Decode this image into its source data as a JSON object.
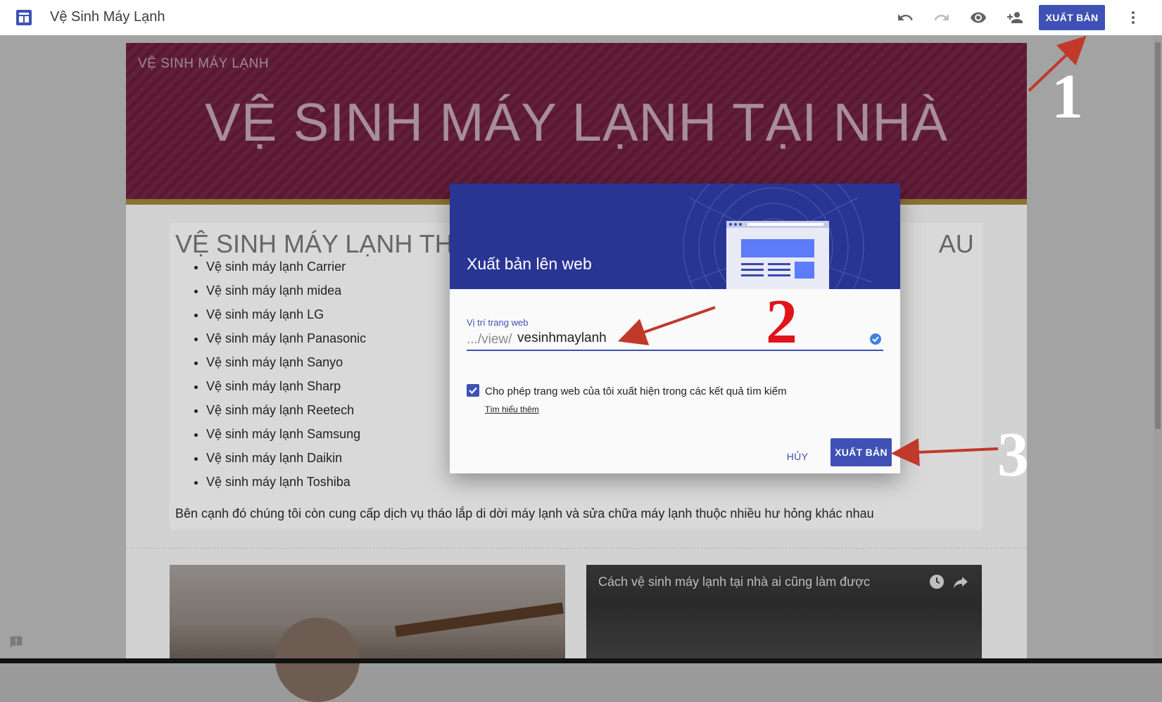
{
  "app": {
    "title": "Vệ Sinh Máy Lạnh",
    "publish_label": "XUẤT BẢN",
    "toolbar_icons": [
      "undo-icon",
      "redo-icon",
      "preview-icon",
      "share-icon",
      "more-vert-icon"
    ]
  },
  "site": {
    "site_name": "VỆ SINH MÁY LẠNH",
    "hero_title": "VỆ SINH MÁY LẠNH TẠI NHÀ",
    "section_title": "VỆ SINH MÁY LẠNH TH",
    "section_title_tail": "AU",
    "brands": [
      "Vệ sinh máy lạnh Carrier",
      "Vệ sinh máy lạnh midea",
      "Vệ sinh máy lạnh LG",
      "Vệ sinh máy lạnh Panasonic",
      "Vệ sinh máy lạnh Sanyo",
      "Vệ sinh máy lạnh Sharp",
      "Vệ sinh máy lạnh Reetech",
      "Vệ sinh máy lạnh Samsung",
      "Vệ sinh máy lạnh Daikin",
      "Vệ sinh máy lạnh Toshiba"
    ],
    "body_text": "Bên cạnh đó chúng tôi còn cung cấp dịch vụ tháo lắp di dời máy lạnh và sửa chữa máy lạnh thuộc nhiều hư hỏng khác nhau",
    "video_title": "Cách vệ sinh máy lạnh tại nhà ai cũng làm được"
  },
  "dialog": {
    "title": "Xuất bản lên web",
    "field_label": "Vị trí trang web",
    "field_prefix": ".../view/",
    "field_value": "vesinhmaylanh",
    "checkbox_checked": true,
    "checkbox_label": "Cho phép trang web của tôi xuất hiện trong các kết quả tìm kiếm",
    "learn_more": "Tìm hiểu thêm",
    "cancel_label": "HỦY",
    "publish_label": "XUẤT BẢN"
  },
  "annotations": {
    "step1": "1",
    "step2": "2",
    "step3": "3",
    "arrow_color": "#c0392b"
  },
  "colors": {
    "primary": "#3f51b5",
    "header_dark": "#283593",
    "hero_bg": "#5e1935"
  }
}
